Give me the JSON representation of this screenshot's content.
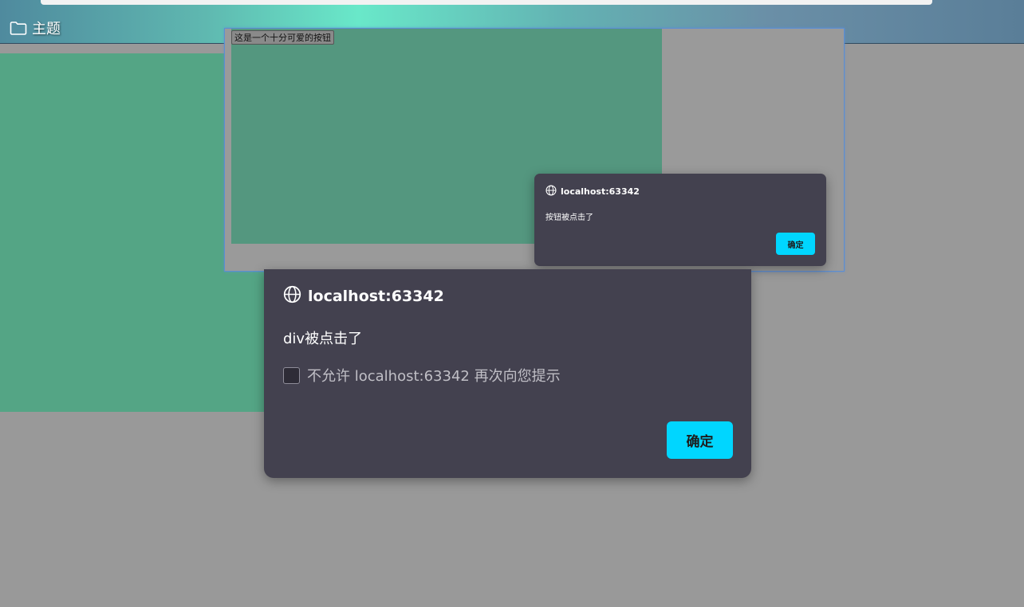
{
  "header": {
    "folder_label": "主题",
    "folder_icon": "folder-icon"
  },
  "iframe": {
    "button_label": "这是一个十分可爱的按钮"
  },
  "small_dialog": {
    "origin": "localhost:63342",
    "message": "按钮被点击了",
    "ok_label": "确定",
    "accent": "#00d6ff"
  },
  "big_dialog": {
    "origin": "localhost:63342",
    "message": "div被点击了",
    "checkbox_label": "不允许 localhost:63342 再次向您提示",
    "ok_label": "确定",
    "accent": "#00d6ff"
  },
  "colors": {
    "page_background": "#999999",
    "green_block": "#54a585",
    "dialog_background": "#43414f"
  }
}
